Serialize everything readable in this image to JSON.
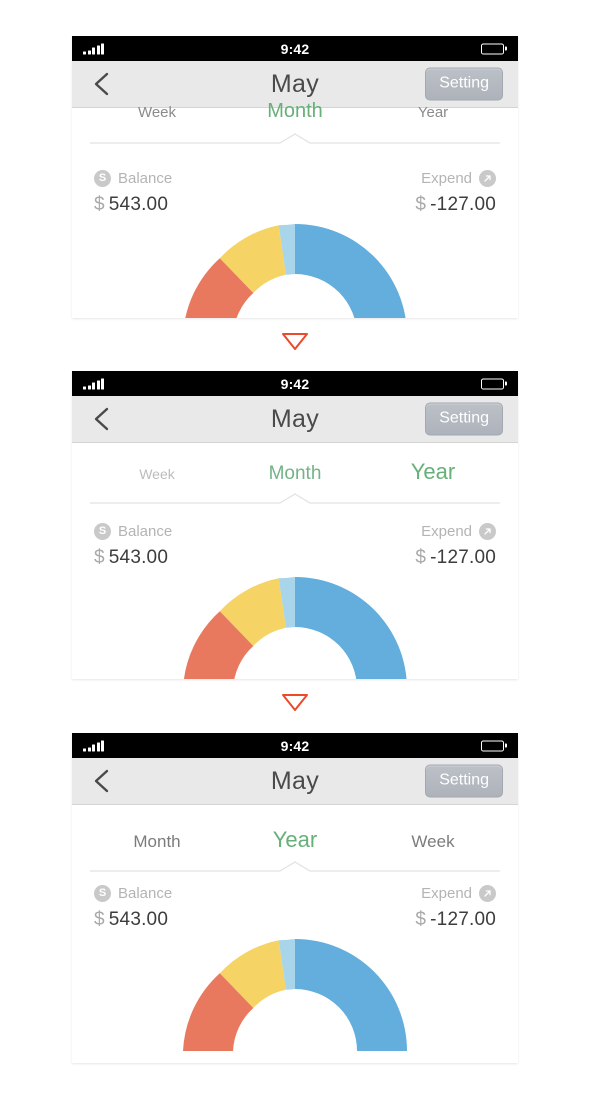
{
  "meta": {
    "app_title": "May",
    "accent_green": "#67b07a",
    "separator_red": "#ec4a2a"
  },
  "statusbar": {
    "time": "9:42",
    "signal_icon": "signal-bars-icon",
    "battery_icon": "battery-icon"
  },
  "navbar": {
    "back_icon": "chevron-left-icon",
    "title": "May",
    "setting_label": "Setting"
  },
  "summary": {
    "balance_label": "Balance",
    "balance_icon": "dollar-circle-icon",
    "balance_currency": "$",
    "balance_amount": "543.00",
    "expend_label": "Expend",
    "expend_icon": "arrow-up-right-circle-icon",
    "expend_currency": "$",
    "expend_amount": "-127.00"
  },
  "separator": {
    "icon": "triangle-down-icon"
  },
  "panels": [
    {
      "name": "panel-month-clipped",
      "tabs": [
        {
          "label": "Week",
          "state": "inactive"
        },
        {
          "label": "Month",
          "state": "active"
        },
        {
          "label": "Year",
          "state": "inactive"
        }
      ]
    },
    {
      "name": "panel-transition",
      "tabs": [
        {
          "label": "Week",
          "state": "fading"
        },
        {
          "label": "Month",
          "state": "active"
        },
        {
          "label": "Year",
          "state": "incoming"
        }
      ]
    },
    {
      "name": "panel-year",
      "tabs": [
        {
          "label": "Month",
          "state": "inactive"
        },
        {
          "label": "Year",
          "state": "active"
        },
        {
          "label": "Week",
          "state": "inactive"
        }
      ]
    }
  ],
  "chart_data": {
    "type": "pie",
    "title": "",
    "shape": "semicircle-donut",
    "start_angle_deg": 0,
    "sweep_deg": 180,
    "direction": "clockwise-from-top",
    "legend": "none",
    "labels": [
      "Blue",
      "Light Blue",
      "Yellow",
      "Red"
    ],
    "values": [
      52,
      10,
      23,
      15
    ],
    "colors": [
      "#63aedd",
      "#a8d5ea",
      "#f5d465",
      "#e8795e"
    ]
  }
}
